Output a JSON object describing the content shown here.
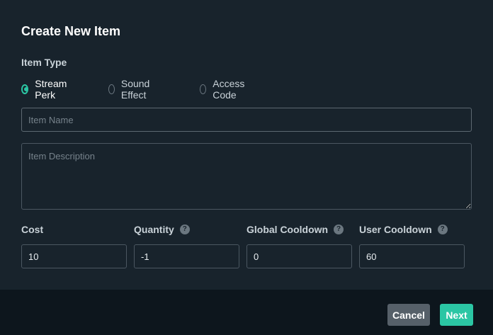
{
  "dialog": {
    "title": "Create New Item",
    "item_type_label": "Item Type",
    "item_types": [
      {
        "label": "Stream Perk",
        "selected": true
      },
      {
        "label": "Sound Effect",
        "selected": false
      },
      {
        "label": "Access Code",
        "selected": false
      }
    ],
    "item_name": {
      "value": "",
      "placeholder": "Item Name"
    },
    "item_description": {
      "value": "",
      "placeholder": "Item Description"
    },
    "fields": {
      "cost": {
        "label": "Cost",
        "value": "10"
      },
      "quantity": {
        "label": "Quantity",
        "value": "-1",
        "help_icon": "question-circle"
      },
      "global_cooldown": {
        "label": "Global Cooldown",
        "value": "0",
        "help_icon": "question-circle"
      },
      "user_cooldown": {
        "label": "User Cooldown",
        "value": "60",
        "help_icon": "question-circle"
      }
    }
  },
  "footer": {
    "cancel_label": "Cancel",
    "next_label": "Next"
  },
  "colors": {
    "background": "#18232c",
    "footer_background": "#0d161d",
    "accent": "#2bc6a4",
    "cancel_button": "#566069"
  }
}
